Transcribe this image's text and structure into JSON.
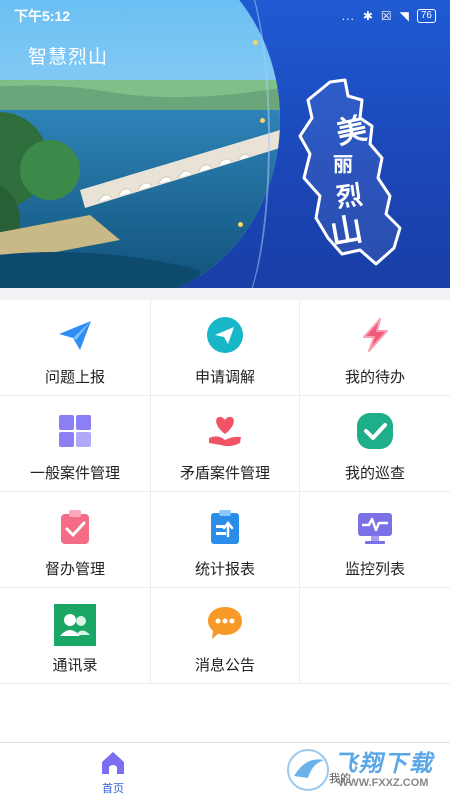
{
  "status_bar": {
    "time": "下午5:12",
    "signal_dots": "...",
    "battery": "76"
  },
  "app": {
    "title": "智慧烈山",
    "banner_text": {
      "c1": "美",
      "c2": "丽",
      "c3": "烈",
      "c4": "山"
    }
  },
  "menu": {
    "items": [
      {
        "label": "问题上报",
        "icon": "paper-plane-icon",
        "color": "#2f8ef5"
      },
      {
        "label": "申请调解",
        "icon": "send-circle-icon",
        "color": "#17b6c9"
      },
      {
        "label": "我的待办",
        "icon": "lightning-icon",
        "color": "#f25a7b"
      },
      {
        "label": "一般案件管理",
        "icon": "grid-blocks-icon",
        "color": "#8a80f4"
      },
      {
        "label": "矛盾案件管理",
        "icon": "heart-hand-icon",
        "color": "#f05365"
      },
      {
        "label": "我的巡查",
        "icon": "check-circle-icon",
        "color": "#1fae8a"
      },
      {
        "label": "督办管理",
        "icon": "clipboard-check-icon",
        "color": "#f46c86"
      },
      {
        "label": "统计报表",
        "icon": "report-clipboard-icon",
        "color": "#2a8de8"
      },
      {
        "label": "监控列表",
        "icon": "monitor-pulse-icon",
        "color": "#7c70e6"
      },
      {
        "label": "通讯录",
        "icon": "contacts-icon",
        "color": "#1aa664"
      },
      {
        "label": "消息公告",
        "icon": "chat-bubble-icon",
        "color": "#f79a2a"
      }
    ]
  },
  "bottom_nav": {
    "home_label": "首页",
    "mine_label": "我的",
    "active_color": "#2f61d5"
  },
  "watermark": {
    "text": "飞翔下载",
    "url": "WWW.FXXZ.COM"
  }
}
